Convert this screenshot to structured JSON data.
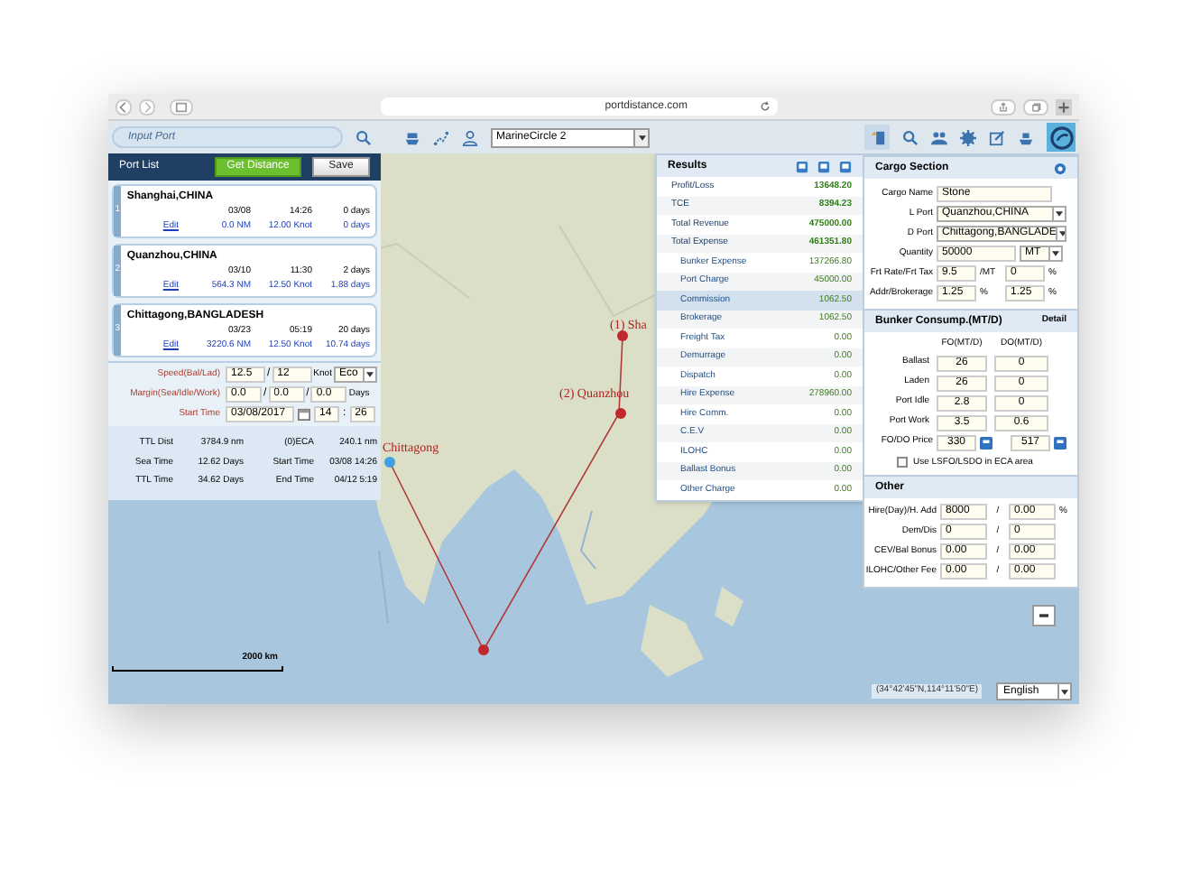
{
  "browser": {
    "url": "portdistance.com"
  },
  "toolbar": {
    "search_placeholder": "Input Port",
    "map_select": "MarineCircle 2"
  },
  "port_list": {
    "title": "Port List",
    "buttons": [
      {
        "label": "Get Distance",
        "kind": "primary"
      },
      {
        "label": "Save",
        "kind": "plain"
      }
    ],
    "ports": [
      {
        "index": "1",
        "name": "Shanghai,CHINA",
        "date": "03/08",
        "time": "14:26",
        "stay": "0 days",
        "link": "Edit",
        "distance": "0.0 NM",
        "speed": "12.00 Knot",
        "sea_days": "0 days"
      },
      {
        "index": "2",
        "name": "Quanzhou,CHINA",
        "date": "03/10",
        "time": "11:30",
        "stay": "2 days",
        "link": "Edit",
        "distance": "564.3 NM",
        "speed": "12.50 Knot",
        "sea_days": "1.88 days"
      },
      {
        "index": "3",
        "name": "Chittagong,BANGLADESH",
        "date": "03/23",
        "time": "05:19",
        "stay": "20 days",
        "link": "Edit",
        "distance": "3220.6 NM",
        "speed": "12.50 Knot",
        "sea_days": "10.74 days"
      }
    ]
  },
  "voyage_settings": {
    "speed_label": "Speed(Bal/Lad)",
    "speed_ballast": "12.5",
    "speed_separator": "/",
    "speed_laden": "12",
    "speed_unit": "Knot",
    "speed_mode": "Eco",
    "margin_label": "Margin(Sea/Idle/Work)",
    "margins": [
      "0.0",
      "0.0",
      "0.0"
    ],
    "margin_separators": [
      "/",
      "/"
    ],
    "margin_unit": "Days",
    "start_label": "Start Time",
    "start_date": "03/08/2017",
    "start_hour": "14",
    "time_separator": ":",
    "start_minute": "26"
  },
  "summary": [
    {
      "label": "TTL Dist",
      "value": "3784.9 nm"
    },
    {
      "label": "(0)ECA",
      "value": "240.1 nm"
    },
    {
      "label": "Sea Time",
      "value": "12.62 Days"
    },
    {
      "label": "Start Time",
      "value": "03/08 14:26"
    },
    {
      "label": "TTL Time",
      "value": "34.62 Days"
    },
    {
      "label": "End Time",
      "value": "04/12 5:19"
    }
  ],
  "results": {
    "title": "Results",
    "rows": [
      {
        "label": "Profit/Loss",
        "value": "13648.20",
        "selected": false
      },
      {
        "label": "TCE",
        "value": "8394.23",
        "selected": false
      },
      {
        "label": "Total Revenue",
        "value": "475000.00",
        "selected": false
      },
      {
        "label": "Total Expense",
        "value": "461351.80",
        "selected": false,
        "children": [
          {
            "label": "Bunker Expense",
            "value": "137266.80",
            "selected": false
          },
          {
            "label": "Port Charge",
            "value": "45000.00",
            "selected": false
          },
          {
            "label": "Commission",
            "value": "1062.50",
            "selected": true
          },
          {
            "label": "Brokerage",
            "value": "1062.50",
            "selected": false
          },
          {
            "label": "Freight Tax",
            "value": "0.00",
            "selected": false
          },
          {
            "label": "Demurrage",
            "value": "0.00",
            "selected": false
          },
          {
            "label": "Dispatch",
            "value": "0.00",
            "selected": false
          },
          {
            "label": "Hire Expense",
            "value": "278960.00",
            "selected": false
          },
          {
            "label": "Hire Comm.",
            "value": "0.00",
            "selected": false
          },
          {
            "label": "C.E.V",
            "value": "0.00",
            "selected": false
          },
          {
            "label": "ILOHC",
            "value": "0.00",
            "selected": false
          },
          {
            "label": "Ballast Bonus",
            "value": "0.00",
            "selected": false
          },
          {
            "label": "Other Charge",
            "value": "0.00",
            "selected": false
          }
        ]
      }
    ]
  },
  "cargo_section": {
    "title": "Cargo Section",
    "fields": [
      {
        "label": "Cargo Name",
        "kind": "text",
        "value": "Stone"
      },
      {
        "label": "L Port",
        "kind": "select",
        "value": "Quanzhou,CHINA"
      },
      {
        "label": "D Port",
        "kind": "select",
        "value": "Chittagong,BANGLADE"
      },
      {
        "label": "Quantity",
        "kind": "unit",
        "value": "50000",
        "unit": "MT"
      },
      {
        "label": "Frt Rate/Frt Tax",
        "kind": "pair",
        "value": "9.5",
        "unit": "/MT",
        "value2": "0",
        "unit2": "%"
      },
      {
        "label": "Addr/Brokerage",
        "kind": "pair",
        "value": "1.25",
        "unit": "%",
        "value2": "1.25",
        "unit2": "%"
      }
    ]
  },
  "bunker_section": {
    "title": "Bunker Consump.(MT/D)",
    "detail": "Detail",
    "columns": [
      "FO(MT/D)",
      "DO(MT/D)"
    ],
    "rows": [
      {
        "label": "Ballast",
        "fo": "26",
        "do": "0"
      },
      {
        "label": "Laden",
        "fo": "26",
        "do": "0"
      },
      {
        "label": "Port Idle",
        "fo": "2.8",
        "do": "0"
      },
      {
        "label": "Port Work",
        "fo": "3.5",
        "do": "0.6"
      }
    ],
    "price_label": "FO/DO Price",
    "fo_price": "330",
    "do_price": "517",
    "eca_option": {
      "label": "Use LSFO/LSDO in ECA area",
      "checked": false
    }
  },
  "other_section": {
    "title": "Other",
    "rows": [
      {
        "label": "Hire(Day)/H. Add",
        "value": "8000",
        "separator": "/",
        "value2": "0.00",
        "unit": "%"
      },
      {
        "label": "Dem/Dis",
        "value": "0",
        "separator": "/",
        "value2": "0"
      },
      {
        "label": "CEV/Bal Bonus",
        "value": "0.00",
        "separator": "/",
        "value2": "0.00"
      },
      {
        "label": "ILOHC/Other Fee",
        "value": "0.00",
        "separator": "/",
        "value2": "0.00"
      }
    ]
  },
  "map": {
    "markers": [
      {
        "label": "(1) Sha"
      },
      {
        "label": "(2) Quanzhou"
      },
      {
        "label": "Chittagong"
      }
    ],
    "scale": "2000 km",
    "coordinates": "(34°42'45\"N,114°11'50\"E)",
    "language": "English"
  }
}
